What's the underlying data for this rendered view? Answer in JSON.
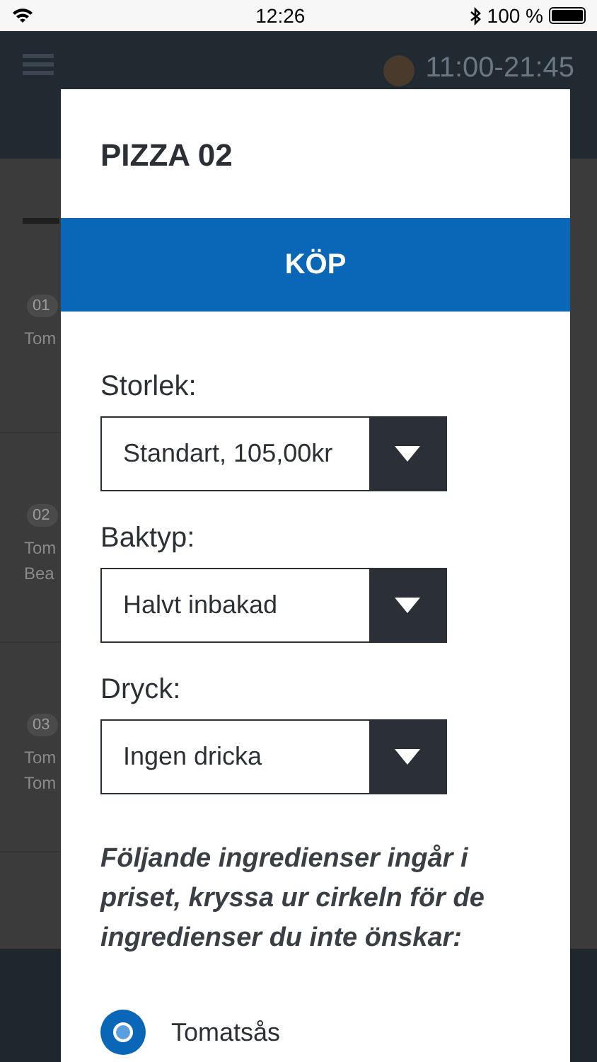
{
  "status_bar": {
    "time": "12:26",
    "battery": "100 %"
  },
  "header": {
    "hours": "11:00-21:45"
  },
  "menu_items": [
    {
      "number": "01",
      "lines": [
        "Tom"
      ]
    },
    {
      "number": "02",
      "lines": [
        "Tom",
        "Bea"
      ]
    },
    {
      "number": "03",
      "lines": [
        "Tom",
        "Tom"
      ]
    }
  ],
  "dialog": {
    "title": "PIZZA 02",
    "buy_button": "KÖP",
    "selects": [
      {
        "label": "Storlek:",
        "value": "Standart, 105,00kr"
      },
      {
        "label": "Baktyp:",
        "value": "Halvt inbakad"
      },
      {
        "label": "Dryck:",
        "value": "Ingen dricka"
      }
    ],
    "instructions": "Följande ingredienser ingår i priset, kryssa ur cirkeln för de ingredienser du inte önskar:",
    "ingredients": [
      {
        "name": "Tomatsås",
        "checked": true
      }
    ]
  }
}
